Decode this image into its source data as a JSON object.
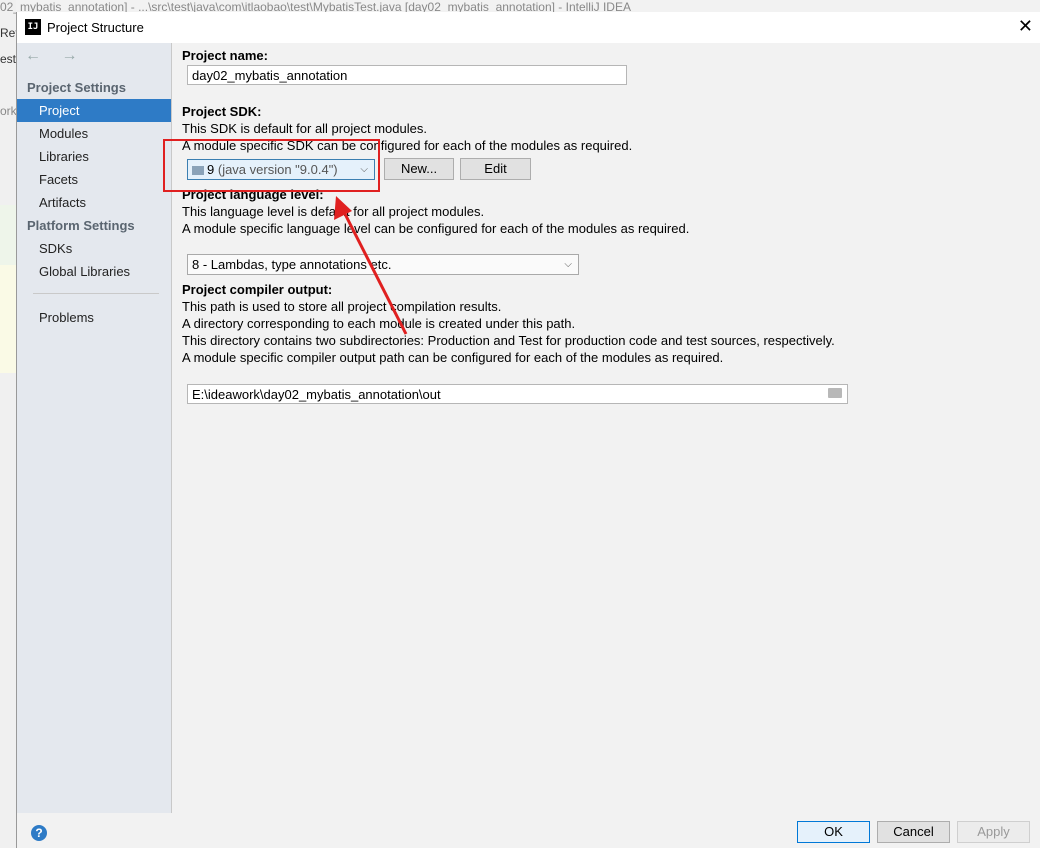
{
  "background": {
    "title": "02_mybatis_annotation] - ...\\src\\test\\java\\com\\itlaobao\\test\\MybatisTest.java [day02_mybatis_annotation] - IntelliJ IDEA",
    "left_labels": [
      "Ref",
      "est",
      "ork"
    ]
  },
  "dialog": {
    "title": "Project Structure",
    "app_icon": "IJ",
    "close_icon": "close-icon"
  },
  "sidebar": {
    "nav_arrows": "← →",
    "project_settings_header": "Project Settings",
    "project_settings_items": [
      {
        "label": "Project",
        "selected": true
      },
      {
        "label": "Modules"
      },
      {
        "label": "Libraries"
      },
      {
        "label": "Facets"
      },
      {
        "label": "Artifacts"
      }
    ],
    "platform_settings_header": "Platform Settings",
    "platform_settings_items": [
      {
        "label": "SDKs"
      },
      {
        "label": "Global Libraries"
      }
    ],
    "problems_label": "Problems"
  },
  "project": {
    "name_label": "Project name:",
    "name_value": "day02_mybatis_annotation",
    "sdk_label": "Project SDK:",
    "sdk_desc1": "This SDK is default for all project modules.",
    "sdk_desc2": "A module specific SDK can be configured for each of the modules as required.",
    "sdk_version": "9",
    "sdk_detail": "(java version \"9.0.4\")",
    "sdk_new_button": "New...",
    "sdk_edit_button": "Edit",
    "lang_label": "Project language level:",
    "lang_desc1": "This language level is default for all project modules.",
    "lang_desc2": "A module specific language level can be configured for each of the modules as required.",
    "lang_value": "8 - Lambdas, type annotations etc.",
    "output_label": "Project compiler output:",
    "output_desc1": "This path is used to store all project compilation results.",
    "output_desc2": "A directory corresponding to each module is created under this path.",
    "output_desc3": "This directory contains two subdirectories: Production and Test for production code and test sources, respectively.",
    "output_desc4": "A module specific compiler output path can be configured for each of the modules as required.",
    "output_value": "E:\\ideawork\\day02_mybatis_annotation\\out"
  },
  "buttons": {
    "help": "?",
    "ok": "OK",
    "cancel": "Cancel",
    "apply": "Apply"
  },
  "annotation_color": "#e02020",
  "accent_color": "#2e7bc6"
}
